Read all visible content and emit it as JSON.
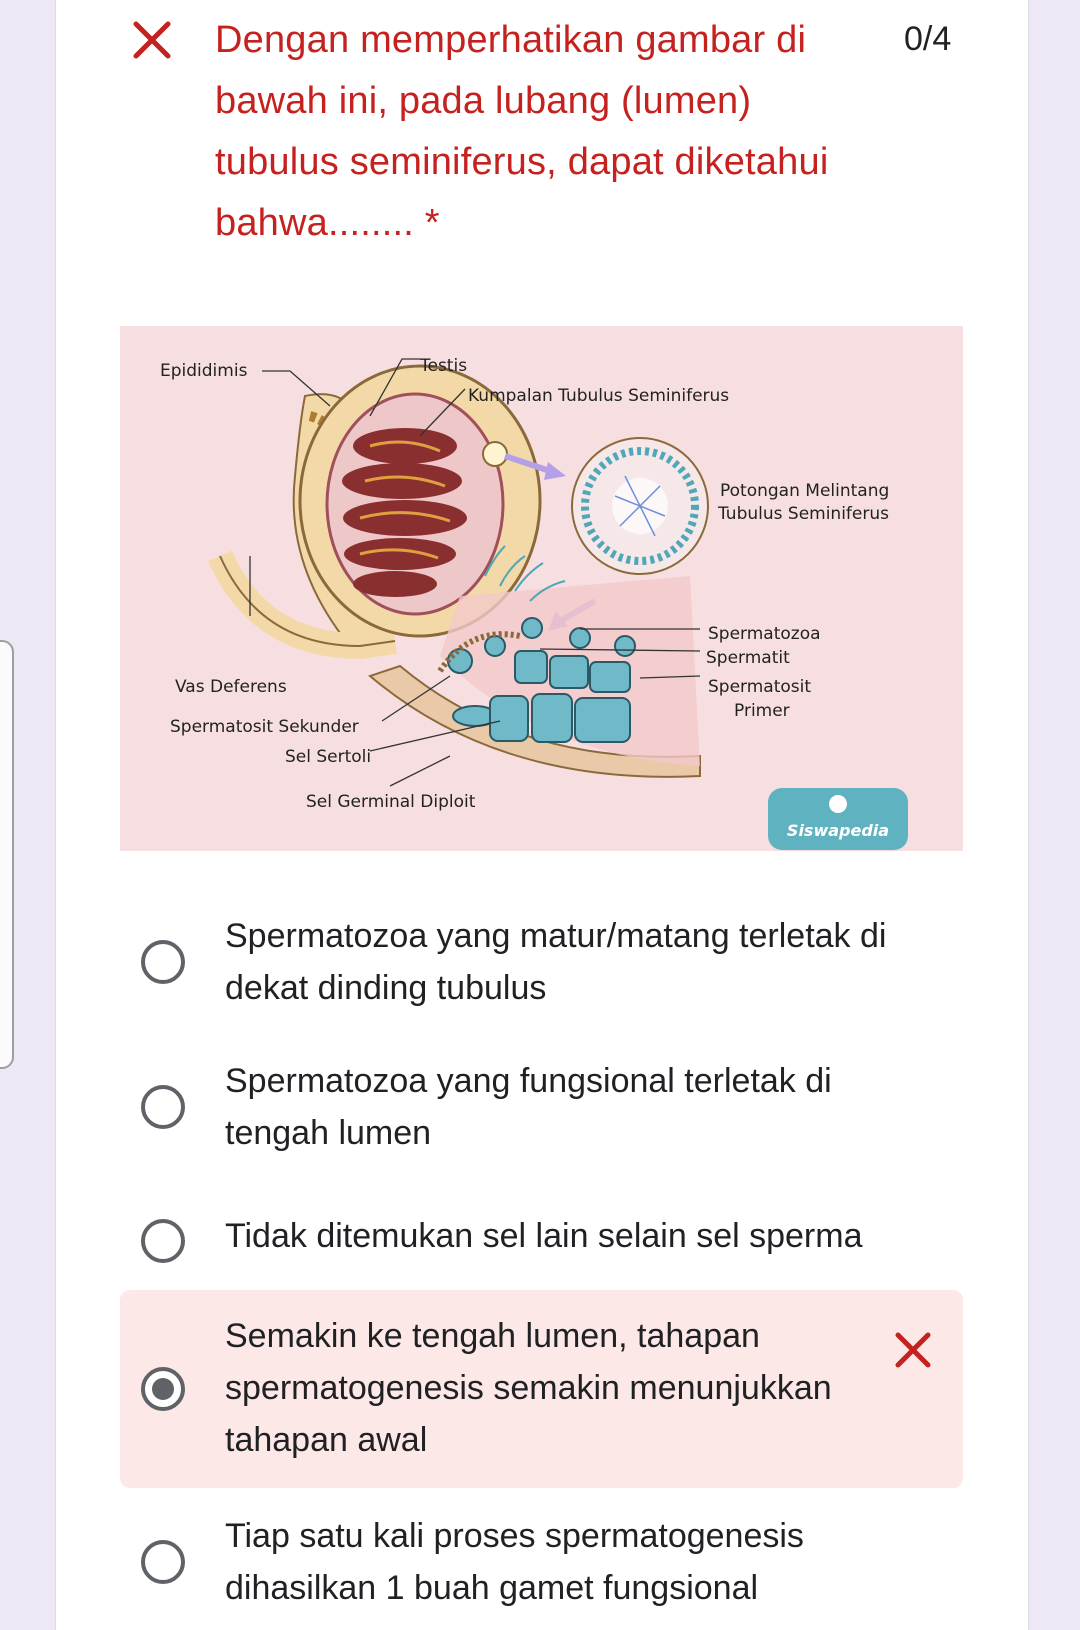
{
  "question": {
    "title": "Dengan memperhatikan gambar di bawah ini, pada lubang (lumen) tubulus seminiferus, dapat diketahui bahwa........ *",
    "score": "0/4",
    "status_icon": "x-icon",
    "status_color": "#c5221f"
  },
  "figure": {
    "labels": {
      "epididimis": "Epididimis",
      "testis": "Testis",
      "kumpalan": "Kumpalan Tubulus Seminiferus",
      "potongan_1": "Potongan Melintang",
      "potongan_2": "Tubulus Seminiferus",
      "spermatozoa": "Spermatozoa",
      "spermatit": "Spermatit",
      "spermatosit_1": "Spermatosit",
      "spermatosit_2": "Primer",
      "vas_deferens": "Vas Deferens",
      "spermatosit_sekunder": "Spermatosit Sekunder",
      "sel_sertoli": "Sel Sertoli",
      "sel_germinal": "Sel Germinal Diploit",
      "watermark": "Siswapedia"
    }
  },
  "options": [
    {
      "label": "Spermatozoa yang matur/matang terletak di dekat dinding tubulus",
      "selected": false
    },
    {
      "label": "Spermatozoa yang fungsional terletak di tengah lumen",
      "selected": false
    },
    {
      "label": "Tidak ditemukan sel lain selain sel sperma",
      "selected": false
    },
    {
      "label": "Semakin ke tengah lumen, tahapan spermatogenesis semakin menunjukkan tahapan awal",
      "selected": true,
      "marked_wrong": true
    },
    {
      "label": "Tiap satu kali proses spermatogenesis dihasilkan 1 buah gamet fungsional",
      "selected": false
    }
  ],
  "colors": {
    "wrong_bg": "#fce8e6",
    "wrong_mark": "#c5221f",
    "page_bg": "#ede7f6"
  }
}
